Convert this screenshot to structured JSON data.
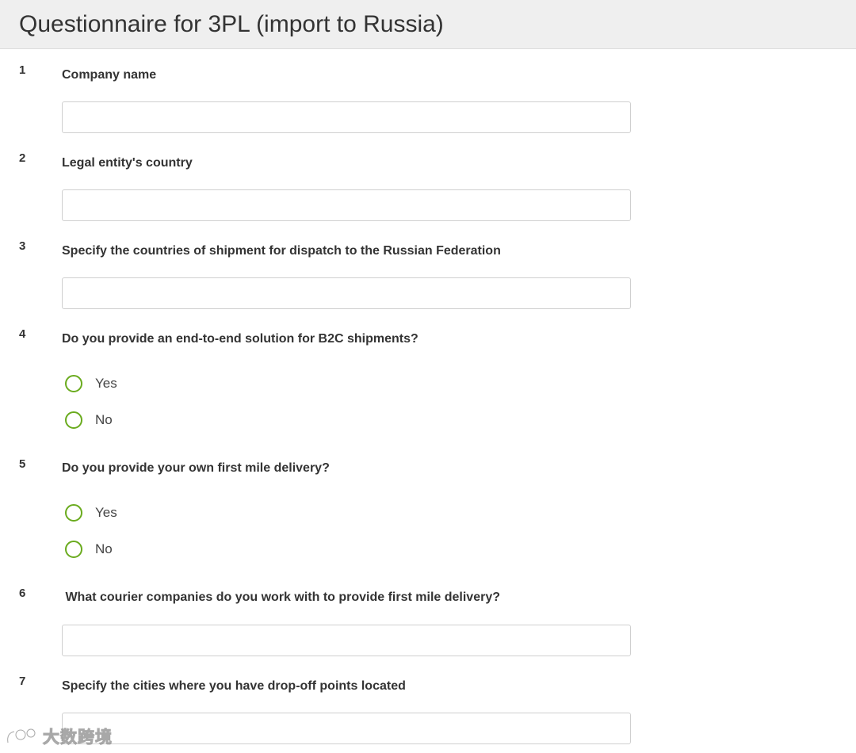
{
  "header": {
    "title": "Questionnaire for 3PL (import to Russia)"
  },
  "questions": [
    {
      "number": "1",
      "text": "Company name",
      "value": ""
    },
    {
      "number": "2",
      "text": "Legal entity's country",
      "value": ""
    },
    {
      "number": "3",
      "text": "Specify the countries of shipment for dispatch to the Russian Federation",
      "value": ""
    },
    {
      "number": "4",
      "text": "Do you provide an end-to-end solution for B2C shipments?",
      "options": [
        "Yes",
        "No"
      ]
    },
    {
      "number": "5",
      "text": "Do you provide your own first mile delivery?",
      "options": [
        "Yes",
        "No"
      ]
    },
    {
      "number": "6",
      "text": " What courier companies do you work with to provide first mile delivery?",
      "value": ""
    },
    {
      "number": "7",
      "text": "Specify the cities where you have drop-off points located",
      "value": ""
    }
  ],
  "watermark": {
    "text": "大数跨境"
  },
  "colors": {
    "header_bg": "#efefef",
    "radio_accent": "#6aab1e",
    "text": "#333333",
    "input_border": "#cfcfcf"
  }
}
